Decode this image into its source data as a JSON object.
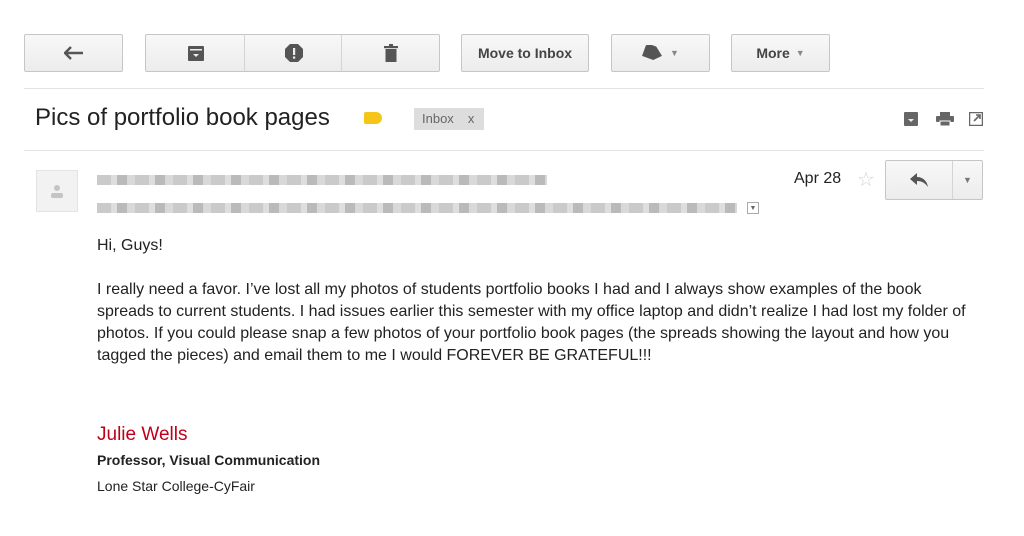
{
  "toolbar": {
    "back_icon": "arrow-left-icon",
    "archive_icon": "archive-icon",
    "spam_icon": "report-spam-icon",
    "delete_icon": "trash-icon",
    "move_label": "Move to Inbox",
    "labels_icon": "label-tag-icon",
    "more_label": "More"
  },
  "email": {
    "subject": "Pics of portfolio book pages",
    "label_color": "#f5c518",
    "inbox_chip": "Inbox",
    "inbox_chip_close": "x",
    "date": "Apr 28",
    "body": {
      "greeting": "Hi, Guys!",
      "paragraph": "I really need a favor. I’ve lost all my photos of students portfolio books I had and I always show examples of the book spreads to current students. I had issues earlier this semester with my office laptop and didn’t realize I had lost my folder of photos. If you could please snap a few photos of your portfolio book pages (the spreads showing the layout and how you tagged the pieces) and email them to me I would FOREVER BE GRATEFUL!!!"
    },
    "signature": {
      "name": "Julie Wells",
      "name_color": "#c0001a",
      "title": "Professor, Visual Communication",
      "org": "Lone Star College-CyFair"
    }
  }
}
